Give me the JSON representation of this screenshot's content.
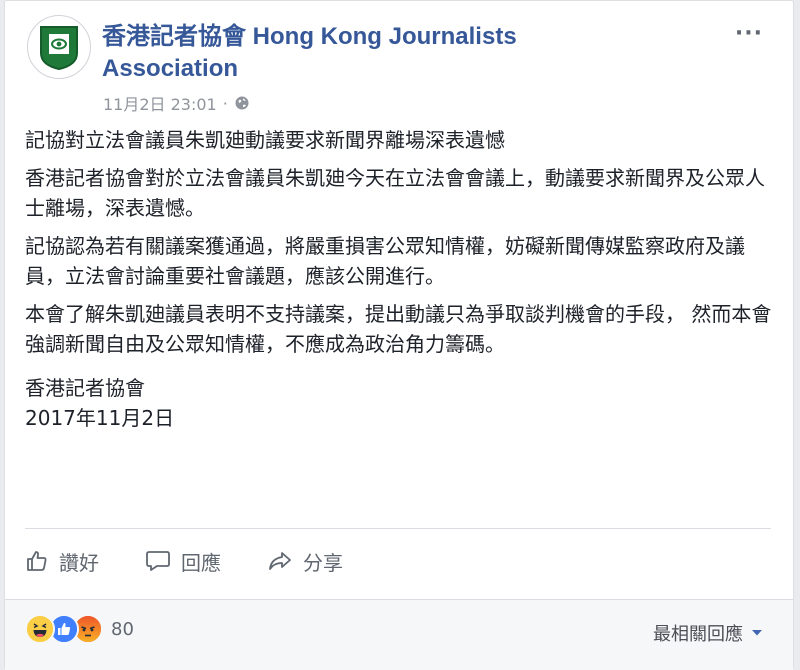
{
  "post": {
    "page_name": "香港記者協會 Hong Kong Journalists Association",
    "timestamp": "11月2日 23:01",
    "separator": "·",
    "privacy_icon": "globe-icon",
    "more_label": "···",
    "paragraphs": [
      "記協對立法會議員朱凱廸動議要求新聞界離場深表遺憾",
      "香港記者協會對於立法會議員朱凱廸今天在立法會會議上，動議要求新聞界及公眾人士離場，深表遺憾。",
      "記協認為若有關議案獲通過，將嚴重損害公眾知情權，妨礙新聞傳媒監察政府及議員，立法會討論重要社會議題，應該公開進行。",
      "本會了解朱凱廸議員表明不支持議案，提出動議只為爭取談判機會的手段， 然而本會強調新聞自由及公眾知情權，不應成為政治角力籌碼。"
    ],
    "signature": "香港記者協會",
    "date": "2017年11月2日"
  },
  "actions": {
    "like_label": "讚好",
    "comment_label": "回應",
    "share_label": "分享"
  },
  "reactions": {
    "types": [
      "haha-icon",
      "like-icon",
      "angry-icon"
    ],
    "count": "80",
    "sort_label": "最相關回應"
  },
  "colors": {
    "link": "#365899",
    "meta": "#90949c",
    "like_blue": "#4080ff",
    "angry": "#f0562a",
    "haha": "#fbce48",
    "logo_green": "#1f7a3a"
  }
}
